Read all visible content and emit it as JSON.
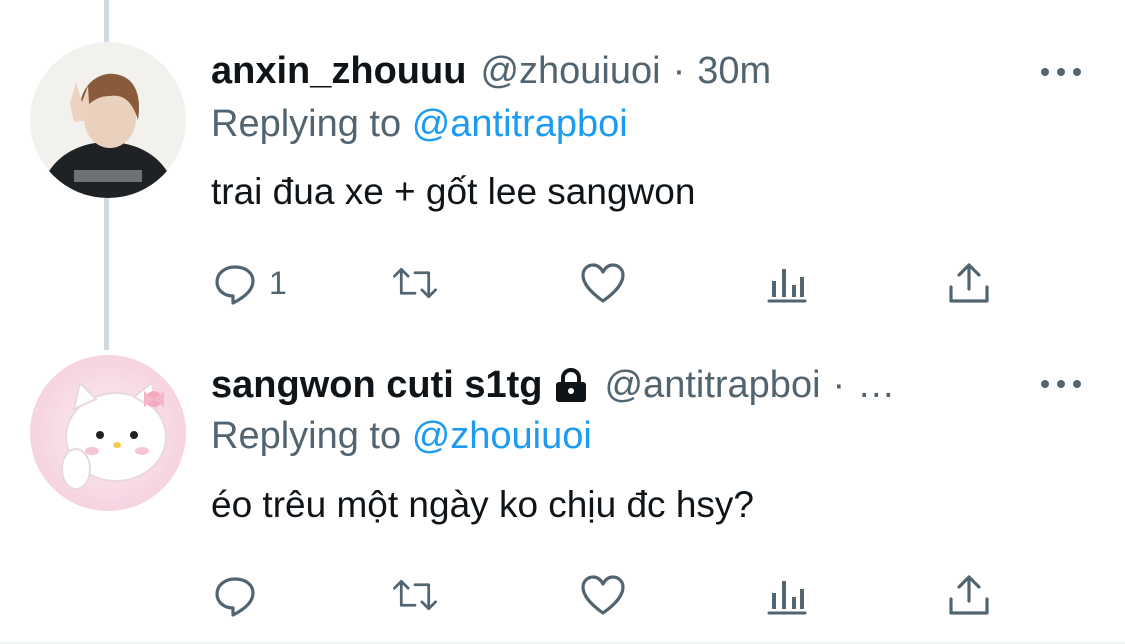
{
  "colors": {
    "text": "#0f1419",
    "secondary": "#536471",
    "link": "#1d9bf0",
    "thread_line": "#cfd9de"
  },
  "tweets": [
    {
      "display_name": "anxin_zhouuu",
      "handle": "@zhouiuoi",
      "separator": "·",
      "time": "30m",
      "replying_label": "Replying to",
      "replying_to": "@antitrapboi",
      "text": "trai đua xe + gốt lee sangwon",
      "reply_count": "1",
      "avatar_icon": "person-photo-avatar"
    },
    {
      "display_name": "sangwon cuti s1tg",
      "protected_icon": "lock-icon",
      "handle": "@antitrapboi",
      "separator": "·",
      "time": "…",
      "replying_label": "Replying to",
      "replying_to": "@zhouiuoi",
      "text": "éo trêu một ngày ko chịu đc hsy?",
      "reply_count": "",
      "avatar_icon": "hello-kitty-avatar"
    }
  ]
}
